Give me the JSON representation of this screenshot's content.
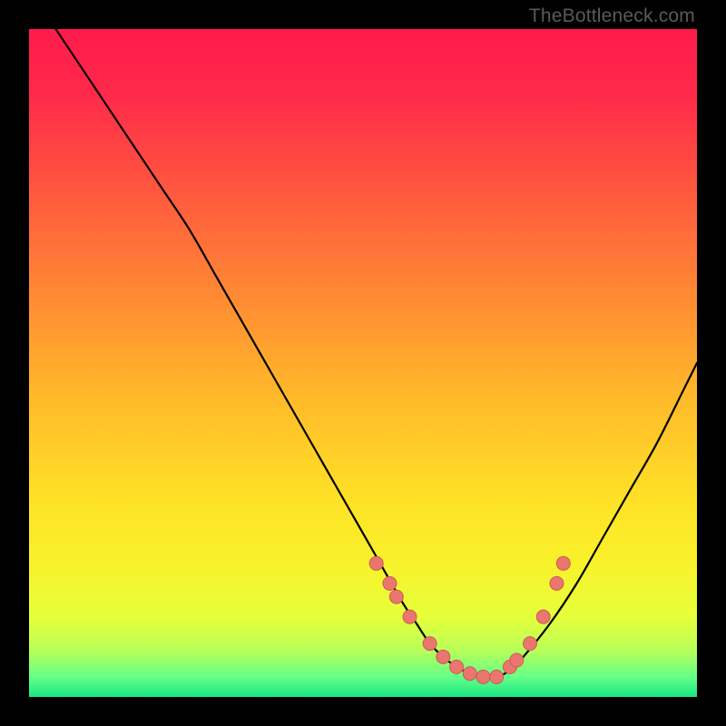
{
  "watermark": "TheBottleneck.com",
  "colors": {
    "background": "#000000",
    "gradient_stops": [
      {
        "offset": 0.0,
        "color": "#ff1a4b"
      },
      {
        "offset": 0.1,
        "color": "#ff2a4a"
      },
      {
        "offset": 0.25,
        "color": "#ff5a3e"
      },
      {
        "offset": 0.4,
        "color": "#ff8a33"
      },
      {
        "offset": 0.55,
        "color": "#ffb92a"
      },
      {
        "offset": 0.7,
        "color": "#ffe026"
      },
      {
        "offset": 0.8,
        "color": "#f8f22a"
      },
      {
        "offset": 0.88,
        "color": "#e6ff3a"
      },
      {
        "offset": 0.93,
        "color": "#b9ff58"
      },
      {
        "offset": 0.97,
        "color": "#66ff88"
      },
      {
        "offset": 1.0,
        "color": "#17e884"
      }
    ],
    "curve": "#000000",
    "marker_fill": "#e9766f",
    "marker_stroke": "#cf5a55"
  },
  "chart_data": {
    "type": "line",
    "title": "",
    "xlabel": "",
    "ylabel": "",
    "xlim": [
      0,
      100
    ],
    "ylim": [
      0,
      100
    ],
    "grid": false,
    "legend": false,
    "series": [
      {
        "name": "curve",
        "x": [
          4,
          8,
          12,
          16,
          20,
          24,
          28,
          32,
          36,
          40,
          44,
          48,
          52,
          56,
          58,
          60,
          62,
          64,
          66,
          68,
          70,
          72,
          74,
          78,
          82,
          86,
          90,
          94,
          98,
          100
        ],
        "y": [
          100,
          94,
          88,
          82,
          76,
          70,
          63,
          56,
          49,
          42,
          35,
          28,
          21,
          14,
          11,
          8,
          6,
          4.5,
          3.5,
          3,
          3,
          4,
          6,
          11,
          17,
          24,
          31,
          38,
          46,
          50
        ]
      }
    ],
    "markers": {
      "name": "highlight-points",
      "x": [
        52,
        54,
        55,
        57,
        60,
        62,
        64,
        66,
        68,
        70,
        72,
        73,
        75,
        77,
        79,
        80
      ],
      "y": [
        20,
        17,
        15,
        12,
        8,
        6,
        4.5,
        3.5,
        3,
        3,
        4.5,
        5.5,
        8,
        12,
        17,
        20
      ]
    }
  }
}
